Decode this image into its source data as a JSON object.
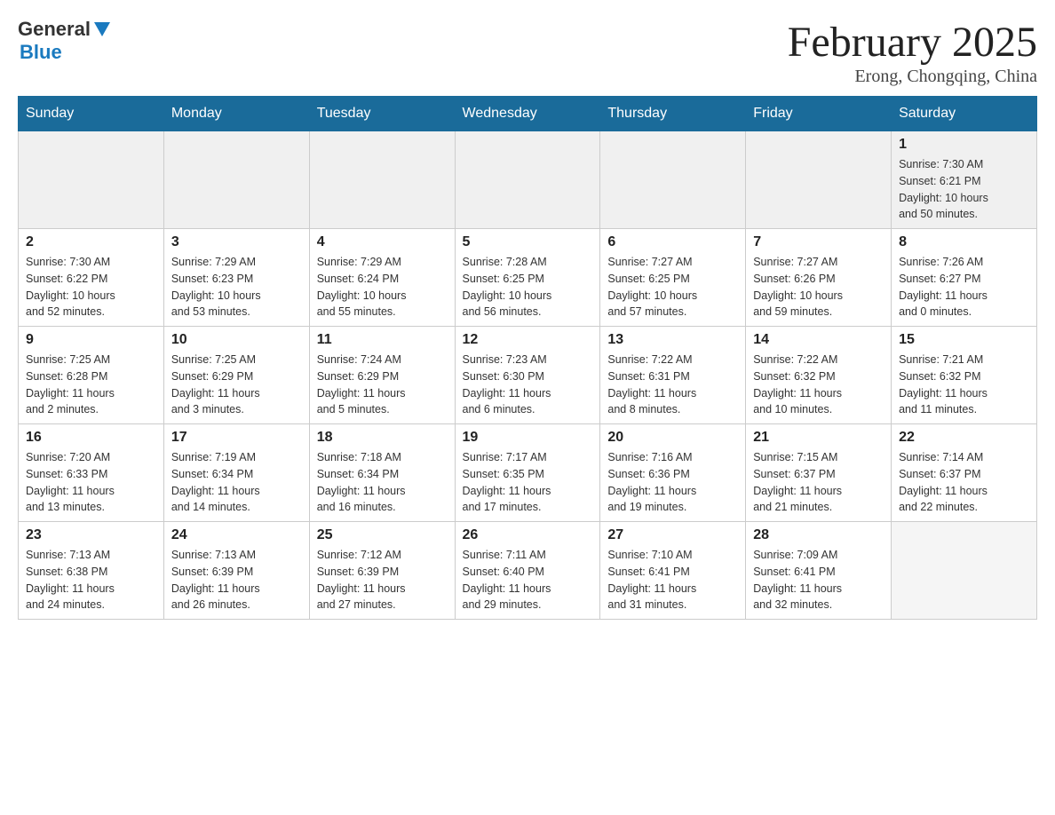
{
  "header": {
    "logo_general": "General",
    "logo_blue": "Blue",
    "month_title": "February 2025",
    "location": "Erong, Chongqing, China"
  },
  "days_of_week": [
    "Sunday",
    "Monday",
    "Tuesday",
    "Wednesday",
    "Thursday",
    "Friday",
    "Saturday"
  ],
  "weeks": [
    {
      "days": [
        {
          "num": "",
          "info": ""
        },
        {
          "num": "",
          "info": ""
        },
        {
          "num": "",
          "info": ""
        },
        {
          "num": "",
          "info": ""
        },
        {
          "num": "",
          "info": ""
        },
        {
          "num": "",
          "info": ""
        },
        {
          "num": "1",
          "info": "Sunrise: 7:30 AM\nSunset: 6:21 PM\nDaylight: 10 hours\nand 50 minutes."
        }
      ]
    },
    {
      "days": [
        {
          "num": "2",
          "info": "Sunrise: 7:30 AM\nSunset: 6:22 PM\nDaylight: 10 hours\nand 52 minutes."
        },
        {
          "num": "3",
          "info": "Sunrise: 7:29 AM\nSunset: 6:23 PM\nDaylight: 10 hours\nand 53 minutes."
        },
        {
          "num": "4",
          "info": "Sunrise: 7:29 AM\nSunset: 6:24 PM\nDaylight: 10 hours\nand 55 minutes."
        },
        {
          "num": "5",
          "info": "Sunrise: 7:28 AM\nSunset: 6:25 PM\nDaylight: 10 hours\nand 56 minutes."
        },
        {
          "num": "6",
          "info": "Sunrise: 7:27 AM\nSunset: 6:25 PM\nDaylight: 10 hours\nand 57 minutes."
        },
        {
          "num": "7",
          "info": "Sunrise: 7:27 AM\nSunset: 6:26 PM\nDaylight: 10 hours\nand 59 minutes."
        },
        {
          "num": "8",
          "info": "Sunrise: 7:26 AM\nSunset: 6:27 PM\nDaylight: 11 hours\nand 0 minutes."
        }
      ]
    },
    {
      "days": [
        {
          "num": "9",
          "info": "Sunrise: 7:25 AM\nSunset: 6:28 PM\nDaylight: 11 hours\nand 2 minutes."
        },
        {
          "num": "10",
          "info": "Sunrise: 7:25 AM\nSunset: 6:29 PM\nDaylight: 11 hours\nand 3 minutes."
        },
        {
          "num": "11",
          "info": "Sunrise: 7:24 AM\nSunset: 6:29 PM\nDaylight: 11 hours\nand 5 minutes."
        },
        {
          "num": "12",
          "info": "Sunrise: 7:23 AM\nSunset: 6:30 PM\nDaylight: 11 hours\nand 6 minutes."
        },
        {
          "num": "13",
          "info": "Sunrise: 7:22 AM\nSunset: 6:31 PM\nDaylight: 11 hours\nand 8 minutes."
        },
        {
          "num": "14",
          "info": "Sunrise: 7:22 AM\nSunset: 6:32 PM\nDaylight: 11 hours\nand 10 minutes."
        },
        {
          "num": "15",
          "info": "Sunrise: 7:21 AM\nSunset: 6:32 PM\nDaylight: 11 hours\nand 11 minutes."
        }
      ]
    },
    {
      "days": [
        {
          "num": "16",
          "info": "Sunrise: 7:20 AM\nSunset: 6:33 PM\nDaylight: 11 hours\nand 13 minutes."
        },
        {
          "num": "17",
          "info": "Sunrise: 7:19 AM\nSunset: 6:34 PM\nDaylight: 11 hours\nand 14 minutes."
        },
        {
          "num": "18",
          "info": "Sunrise: 7:18 AM\nSunset: 6:34 PM\nDaylight: 11 hours\nand 16 minutes."
        },
        {
          "num": "19",
          "info": "Sunrise: 7:17 AM\nSunset: 6:35 PM\nDaylight: 11 hours\nand 17 minutes."
        },
        {
          "num": "20",
          "info": "Sunrise: 7:16 AM\nSunset: 6:36 PM\nDaylight: 11 hours\nand 19 minutes."
        },
        {
          "num": "21",
          "info": "Sunrise: 7:15 AM\nSunset: 6:37 PM\nDaylight: 11 hours\nand 21 minutes."
        },
        {
          "num": "22",
          "info": "Sunrise: 7:14 AM\nSunset: 6:37 PM\nDaylight: 11 hours\nand 22 minutes."
        }
      ]
    },
    {
      "days": [
        {
          "num": "23",
          "info": "Sunrise: 7:13 AM\nSunset: 6:38 PM\nDaylight: 11 hours\nand 24 minutes."
        },
        {
          "num": "24",
          "info": "Sunrise: 7:13 AM\nSunset: 6:39 PM\nDaylight: 11 hours\nand 26 minutes."
        },
        {
          "num": "25",
          "info": "Sunrise: 7:12 AM\nSunset: 6:39 PM\nDaylight: 11 hours\nand 27 minutes."
        },
        {
          "num": "26",
          "info": "Sunrise: 7:11 AM\nSunset: 6:40 PM\nDaylight: 11 hours\nand 29 minutes."
        },
        {
          "num": "27",
          "info": "Sunrise: 7:10 AM\nSunset: 6:41 PM\nDaylight: 11 hours\nand 31 minutes."
        },
        {
          "num": "28",
          "info": "Sunrise: 7:09 AM\nSunset: 6:41 PM\nDaylight: 11 hours\nand 32 minutes."
        },
        {
          "num": "",
          "info": ""
        }
      ]
    }
  ]
}
